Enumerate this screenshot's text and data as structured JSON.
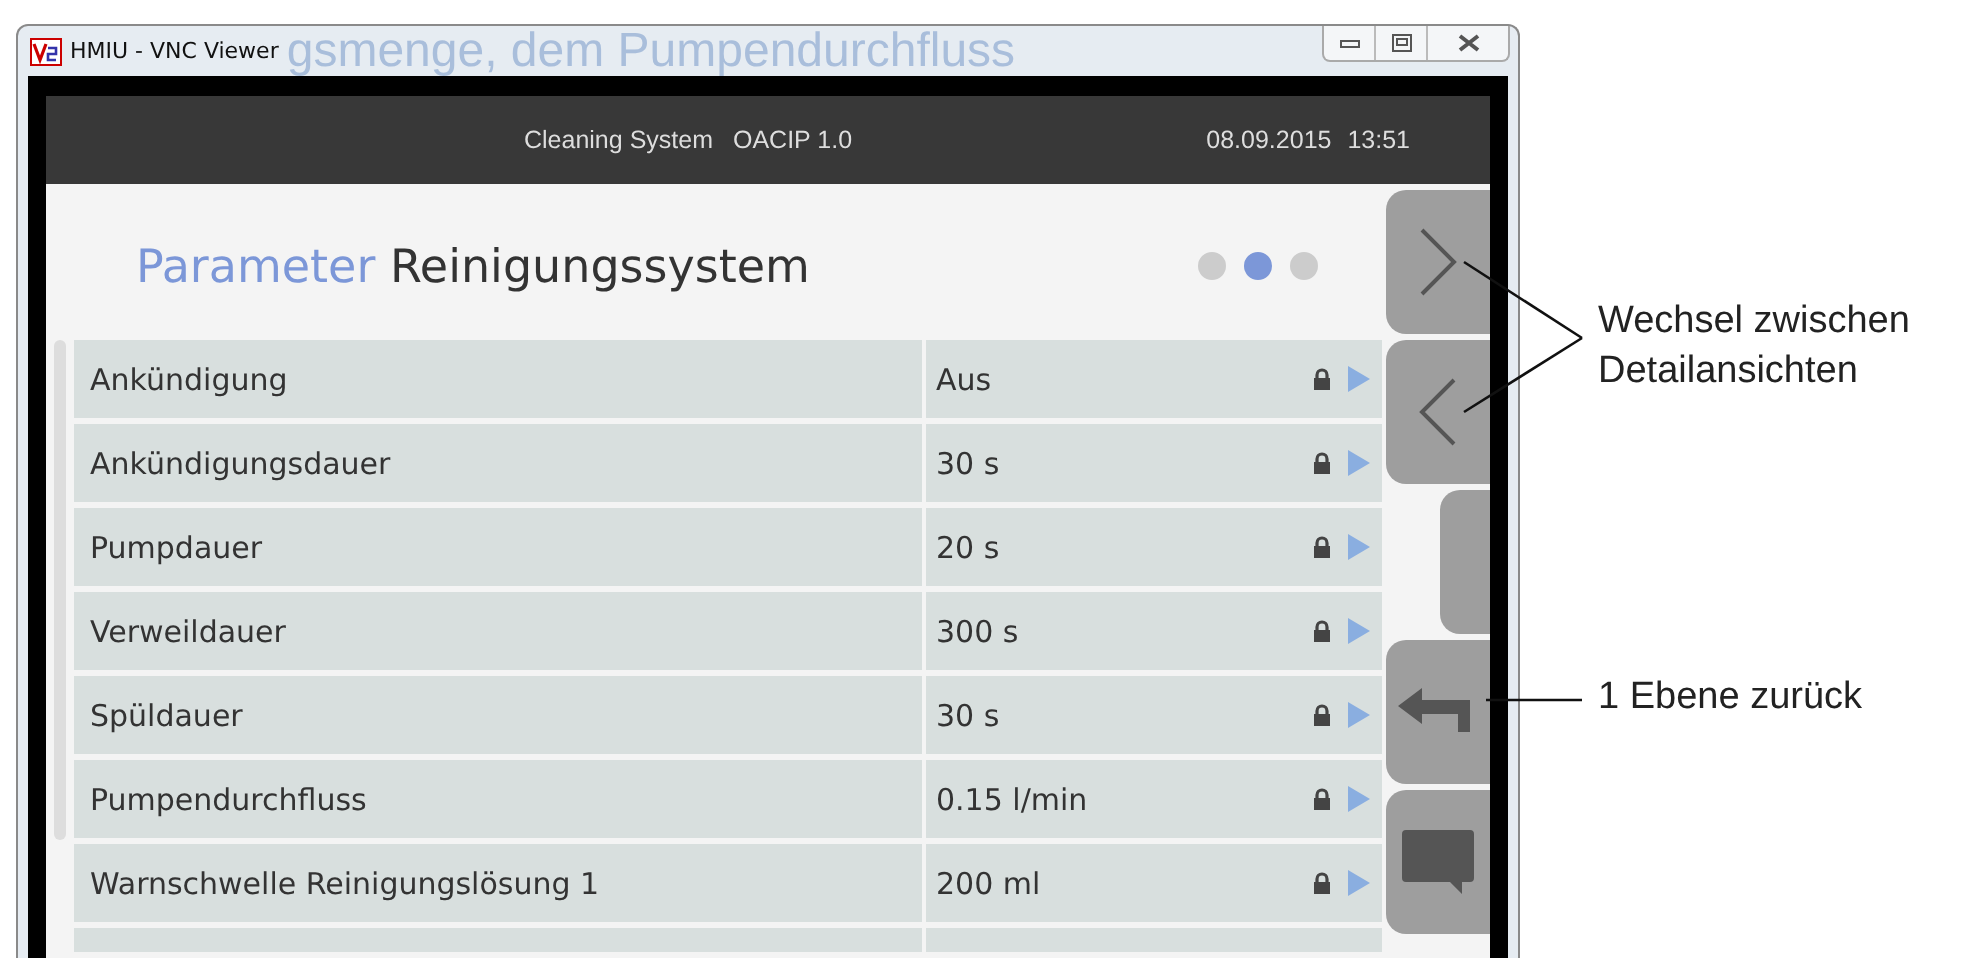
{
  "window": {
    "title": "HMIU - VNC Viewer",
    "background_text": "gsmenge, dem Pumpendurchfluss"
  },
  "header": {
    "system": "Cleaning System",
    "version": "OACIP 1.0",
    "date": "08.09.2015",
    "time": "13:51"
  },
  "page": {
    "title_accent": "Parameter",
    "title": "Reinigungssystem"
  },
  "pages": [
    {
      "selected": false
    },
    {
      "selected": true
    },
    {
      "selected": false
    }
  ],
  "rows": [
    {
      "label": "Ankündigung",
      "value": "Aus",
      "locked": true
    },
    {
      "label": "Ankündigungsdauer",
      "value": "30 s",
      "locked": true
    },
    {
      "label": "Pumpdauer",
      "value": "20 s",
      "locked": true
    },
    {
      "label": "Verweildauer",
      "value": "300 s",
      "locked": true
    },
    {
      "label": "Spüldauer",
      "value": "30 s",
      "locked": true
    },
    {
      "label": "Pumpendurchfluss",
      "value": "0.15 l/min",
      "locked": true
    },
    {
      "label": "Warnschwelle Reinigungslösung 1",
      "value": "200 ml",
      "locked": true
    }
  ],
  "side_buttons": [
    {
      "kind": "next"
    },
    {
      "kind": "prev"
    },
    {
      "kind": "blank"
    },
    {
      "kind": "back"
    },
    {
      "kind": "message"
    }
  ],
  "annotations": [
    {
      "text": "Wechsel zwischen Detailansichten"
    },
    {
      "text": "1 Ebene zurück"
    }
  ]
}
